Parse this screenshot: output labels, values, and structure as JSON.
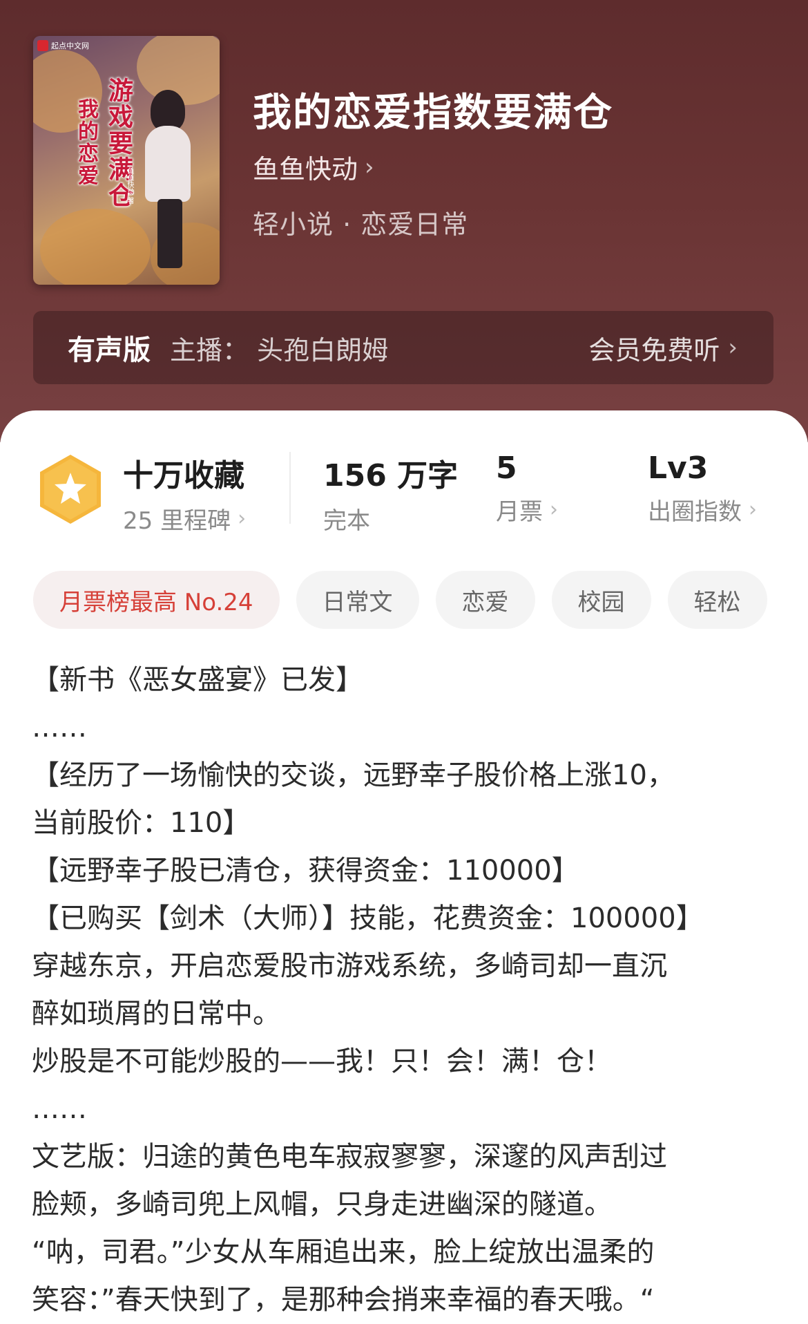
{
  "book": {
    "cover_publisher": "起点中文网",
    "cover_title_line1": "我的恋爱",
    "cover_title_line2": "游戏要满仓",
    "cover_author": "鱼鱼快动 著",
    "title": "我的恋爱指数要满仓",
    "author": "鱼鱼快动",
    "genre": "轻小说 · 恋爱日常"
  },
  "audio": {
    "badge": "有声版",
    "host": "主播：  头孢白朗姆",
    "action": "会员免费听"
  },
  "stats": {
    "collect_main": "十万收藏",
    "collect_sub": "25 里程碑",
    "words_main": "156 万字",
    "words_sub": "完本",
    "tickets_main": "5",
    "tickets_sub": "月票",
    "level_main": "Lv3",
    "level_sub": "出圈指数"
  },
  "tags": [
    "月票榜最高 No.24",
    "日常文",
    "恋爱",
    "校园",
    "轻松"
  ],
  "description": [
    "【新书《恶女盛宴》已发】",
    "……",
    "【经历了一场愉快的交谈，远野幸子股价格上涨10，",
    "当前股价：110】",
    "【远野幸子股已清仓，获得资金：110000】",
    "【已购买【剑术（大师）】技能，花费资金：100000】",
    "穿越东京，开启恋爱股市游戏系统，多崎司却一直沉",
    "醉如琐屑的日常中。",
    "炒股是不可能炒股的——我！只！会！满！仓！",
    "……",
    "文艺版：归途的黄色电车寂寂寥寥，深邃的风声刮过",
    "脸颊，多崎司兜上风帽，只身走进幽深的隧道。",
    "“呐，司君。”少女从车厢追出来，脸上绽放出温柔的",
    "笑容：”春天快到了，是那种会捎来幸福的春天哦。“"
  ],
  "colors": {
    "hero_bg": "#6a3434",
    "hot_tag": "#d64038",
    "medal": "#f5b63c"
  },
  "icons": {
    "medal": "star-medal-icon",
    "chevron": "chevron-right-icon"
  }
}
